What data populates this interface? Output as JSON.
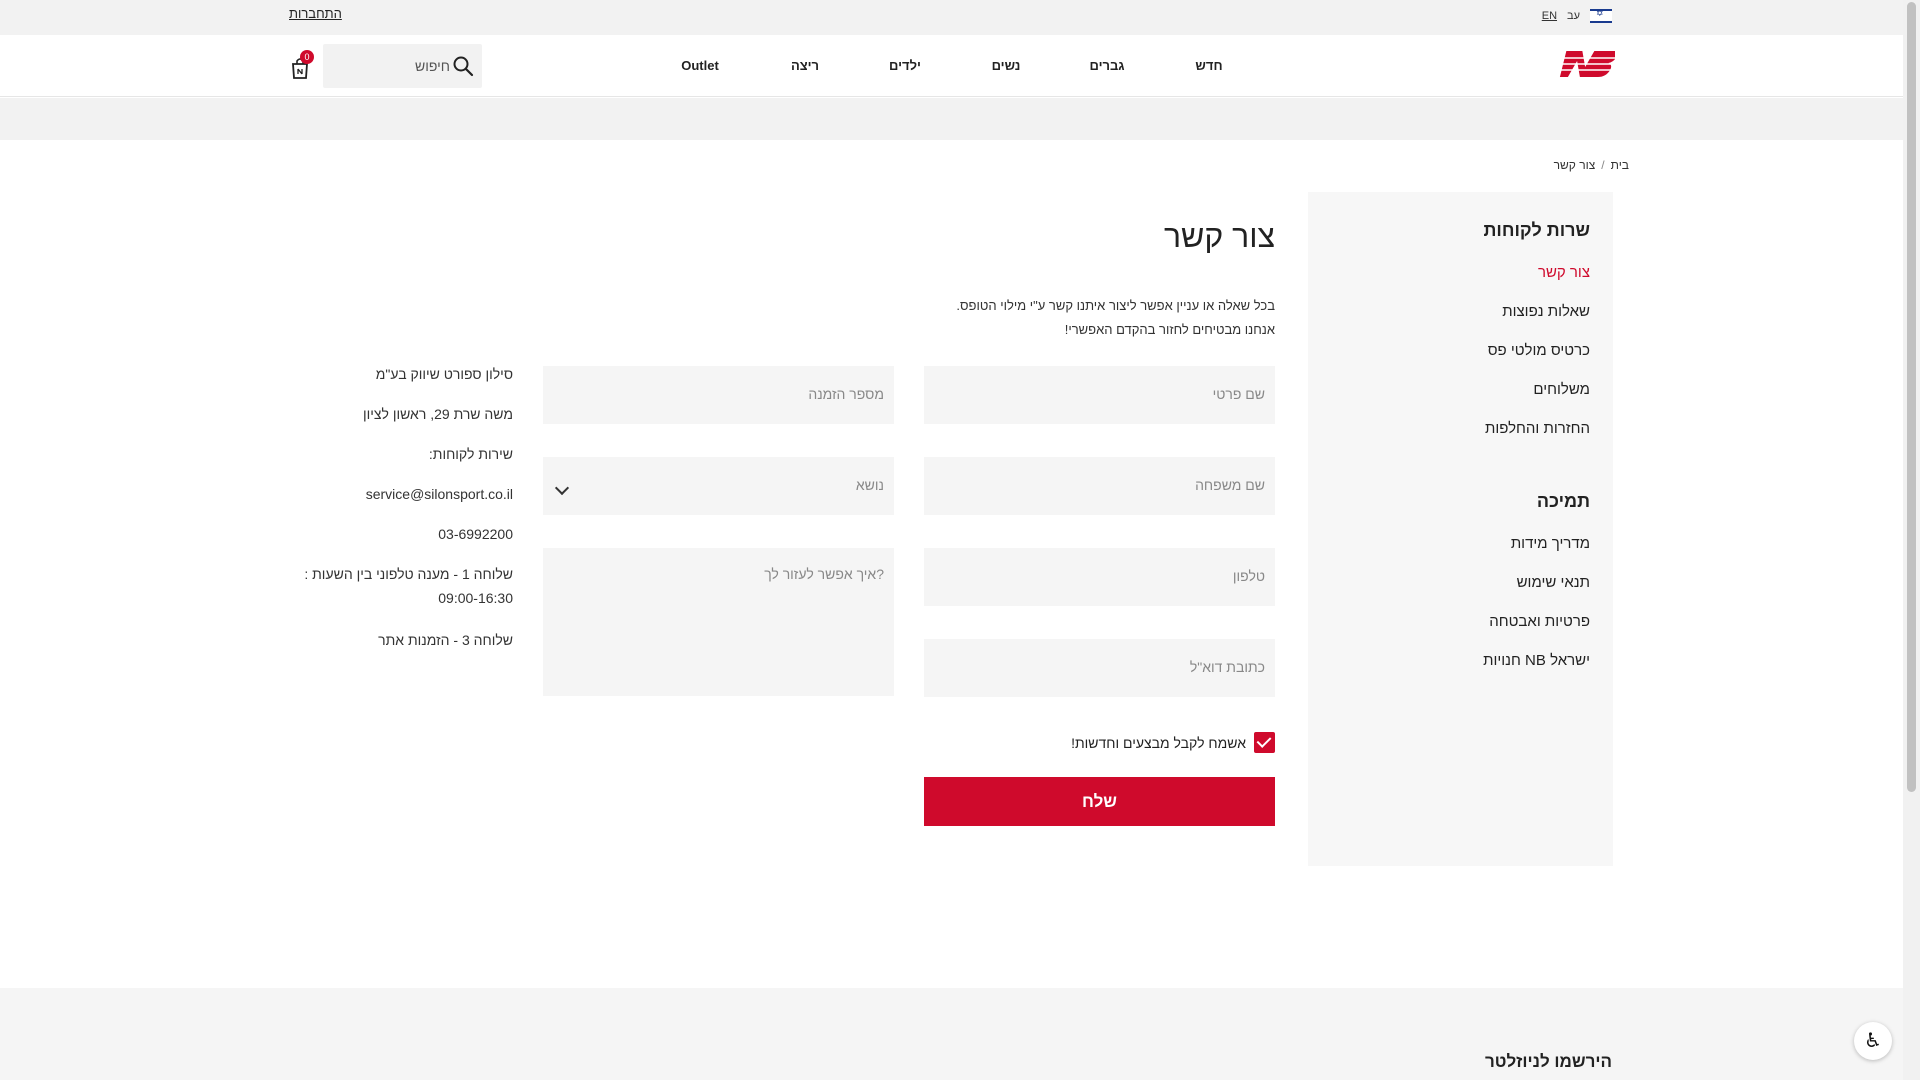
{
  "topbar": {
    "login": "התחברות",
    "lang_en": "EN",
    "lang_he": "עב"
  },
  "header": {
    "nav": [
      "חדש",
      "גברים",
      "נשים",
      "ילדים",
      "ריצה",
      "Outlet"
    ],
    "search_placeholder": "חיפוש",
    "cart_count": "0"
  },
  "breadcrumb": {
    "home": "בית",
    "separator": "/",
    "current": "צור קשר"
  },
  "sidebar": {
    "customer_service": {
      "title": "שרות לקוחות",
      "links": [
        "צור קשר",
        "שאלות נפוצות",
        "כרטיס מולטי פס",
        "משלוחים",
        "החזרות והחלפות"
      ]
    },
    "support": {
      "title": "תמיכה",
      "links": [
        "מדריך מידות",
        "תנאי שימוש",
        "פרטיות ואבטחה",
        "חנויות NB ישראל"
      ]
    }
  },
  "page": {
    "title": "צור קשר",
    "intro_line1": "בכל שאלה או עניין אפשר ליצור איתנו קשר ע\"י מילוי הטופס.",
    "intro_line2": "אנחנו מבטיחים לחזור בהקדם האפשרי!"
  },
  "form": {
    "first_name": "שם פרטי",
    "last_name": "שם משפחה",
    "phone": "טלפון",
    "email": "כתובת דוא\"ל",
    "order_number": "מספר הזמנה",
    "subject": "נושא",
    "message": "איך אפשר לעזור לך?",
    "consent": "אשמח לקבל מבצעים וחדשות!",
    "submit": "שלח"
  },
  "company_info": [
    "סילון ספורט שיווק בע\"מ",
    "משה שרת 29, ראשון לציון",
    "שירות לקוחות:",
    "service@silonsport.co.il",
    "03-6992200",
    "שלוחה 1 - מענה טלפוני בין השעות :",
    "09:00-16:30",
    "שלוחה 3 - הזמנות אתר"
  ],
  "footer": {
    "newsletter": "הירשמו לניוזלטר"
  },
  "colors": {
    "brand_red": "#cf0a2c",
    "light_gray": "#f2f2f2"
  }
}
